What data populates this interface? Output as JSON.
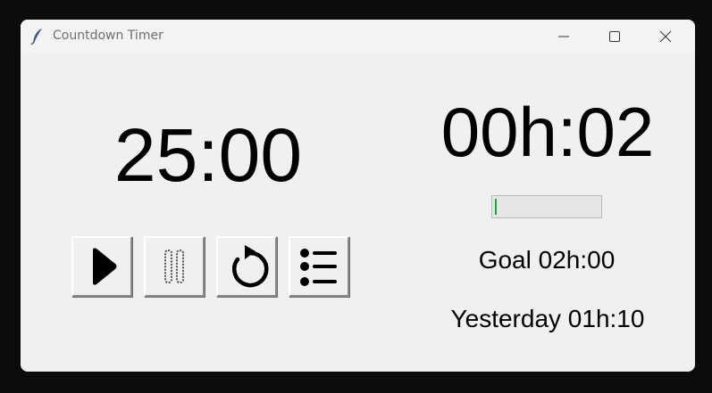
{
  "window": {
    "title": "Countdown Timer",
    "icon": "feather-icon"
  },
  "titlebar_buttons": {
    "minimize": "minimize-icon",
    "maximize": "maximize-icon",
    "close": "close-icon"
  },
  "timer": {
    "countdown": "25:00",
    "elapsed": "00h:02",
    "goal": "Goal 02h:00",
    "yesterday": "Yesterday 01h:10",
    "progress_fraction": 0.017,
    "progress_color": "#06b025"
  },
  "controls": {
    "play": "play-icon",
    "pause": "pause-icon",
    "reset": "reset-icon",
    "list": "list-icon"
  }
}
